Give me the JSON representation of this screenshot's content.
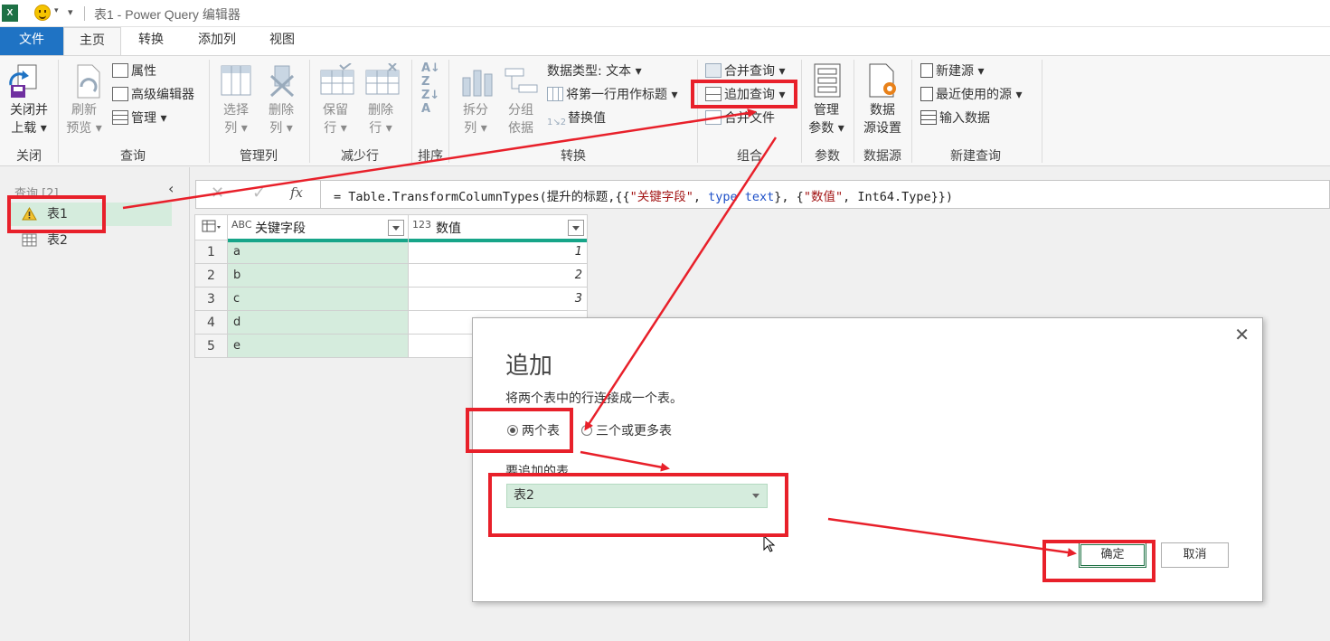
{
  "window": {
    "title": "表1 - Power Query 编辑器",
    "app_icon": "X"
  },
  "tabs": [
    {
      "label": "文件"
    },
    {
      "label": "主页"
    },
    {
      "label": "转换"
    },
    {
      "label": "添加列"
    },
    {
      "label": "视图"
    }
  ],
  "ribbon": {
    "close": {
      "btn1": "关闭并",
      "btn2": "上载",
      "group": "关闭"
    },
    "query": {
      "refresh1": "刷新",
      "refresh2": "预览",
      "properties": "属性",
      "advanced": "高级编辑器",
      "manage": "管理",
      "group": "查询"
    },
    "manage_cols": {
      "choose1": "选择",
      "choose2": "列",
      "remove1": "删除",
      "remove2": "列",
      "group": "管理列"
    },
    "reduce_rows": {
      "keep1": "保留",
      "keep2": "行",
      "remove1": "删除",
      "remove2": "行",
      "group": "减少行"
    },
    "sort": {
      "group": "排序"
    },
    "transform": {
      "split1": "拆分",
      "split2": "列",
      "group1": "分组",
      "group2": "依据",
      "datatype": "数据类型: 文本",
      "first_row": "将第一行用作标题",
      "replace": "替换值",
      "group": "转换"
    },
    "combine": {
      "merge": "合并查询",
      "append": "追加查询",
      "combine_files": "合并文件",
      "group": "组合"
    },
    "params": {
      "manage1": "管理",
      "manage2": "参数",
      "group": "参数"
    },
    "datasource": {
      "settings1": "数据",
      "settings2": "源设置",
      "group": "数据源"
    },
    "new_query": {
      "new_source": "新建源",
      "recent": "最近使用的源",
      "enter_data": "输入数据",
      "group": "新建查询"
    }
  },
  "query_pane": {
    "title": "查询 [2]",
    "items": [
      {
        "label": "表1"
      },
      {
        "label": "表2"
      }
    ]
  },
  "formula": {
    "eq": "= Table.TransformColumnTypes(提升的标题,{{",
    "s1": "\"关键字段\"",
    "mid1": ", ",
    "kw": "type",
    "mid2": " ",
    "kw2": "text",
    "mid3": "}, {",
    "s2": "\"数值\"",
    "tail": ", Int64.Type}})"
  },
  "grid": {
    "col1": {
      "type": "ABC",
      "name": "关键字段"
    },
    "col2": {
      "type": "123",
      "name": "数值"
    },
    "rows": [
      {
        "n": "1",
        "a": "a",
        "b": "1"
      },
      {
        "n": "2",
        "a": "b",
        "b": "2"
      },
      {
        "n": "3",
        "a": "c",
        "b": "3"
      },
      {
        "n": "4",
        "a": "d",
        "b": ""
      },
      {
        "n": "5",
        "a": "e",
        "b": ""
      }
    ]
  },
  "dialog": {
    "title": "追加",
    "description": "将两个表中的行连接成一个表。",
    "radio_two": "两个表",
    "radio_three": "三个或更多表",
    "table_label": "要追加的表",
    "selected_table": "表2",
    "ok": "确定",
    "cancel": "取消"
  },
  "colors": {
    "accent": "#1f73c4",
    "excel_green": "#217346",
    "selection": "#d5ecdd",
    "annotation": "#e8202a"
  }
}
